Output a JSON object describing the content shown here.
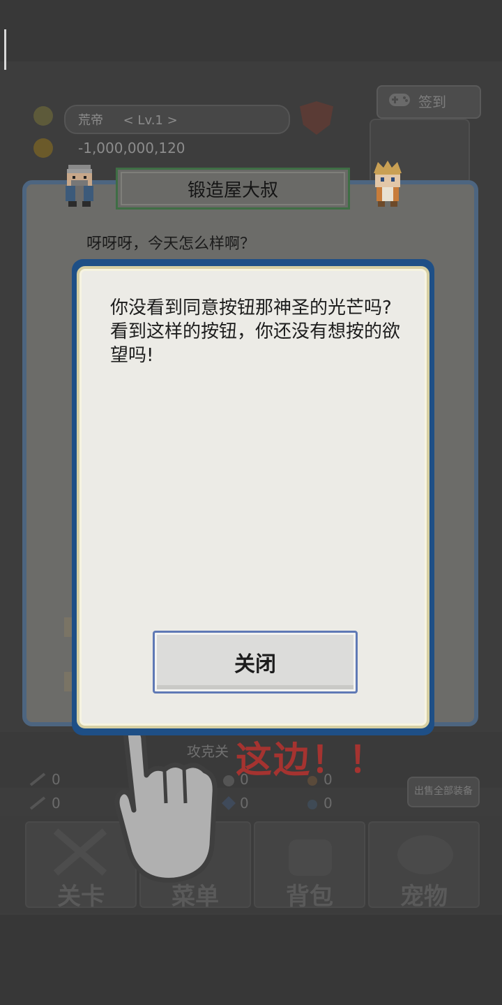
{
  "background": {
    "player_name": "荒帝",
    "player_level": "< Lv.1 >",
    "gold": "-1,000,000,120",
    "gamepad_label": "签到",
    "attack_label": "攻克关",
    "resources": [
      {
        "icon": "sword-icon",
        "value": "0"
      },
      {
        "icon": "bow-icon",
        "value": "0"
      },
      {
        "icon": "potion-icon",
        "value": "0"
      },
      {
        "icon": "gem-icon",
        "value": "0"
      },
      {
        "icon": "drop-icon",
        "value": "0"
      },
      {
        "icon": "stone-icon",
        "value": "0"
      }
    ],
    "sell_all_label": "出售全部装备",
    "nav_tabs": [
      {
        "label": "关卡",
        "icon": "swords-icon"
      },
      {
        "label": "菜单",
        "icon": "menu-icon"
      },
      {
        "label": "背包",
        "icon": "bag-icon"
      },
      {
        "label": "宠物",
        "icon": "pet-icon"
      }
    ]
  },
  "npc_dialog": {
    "title": "锻造屋大叔",
    "line": "呀呀呀，今天怎么样啊？"
  },
  "modal": {
    "message": "你没看到同意按钮那神圣的光芒吗?\n看到这样的按钮，你还没有想按的欲望吗!",
    "close_label": "关闭"
  },
  "hint": {
    "text": "这边！！"
  },
  "colors": {
    "modal_border": "#1e4f86",
    "modal_bg": "#ecebe6",
    "hint_red": "#a53330",
    "button_border": "#5f79b5"
  }
}
